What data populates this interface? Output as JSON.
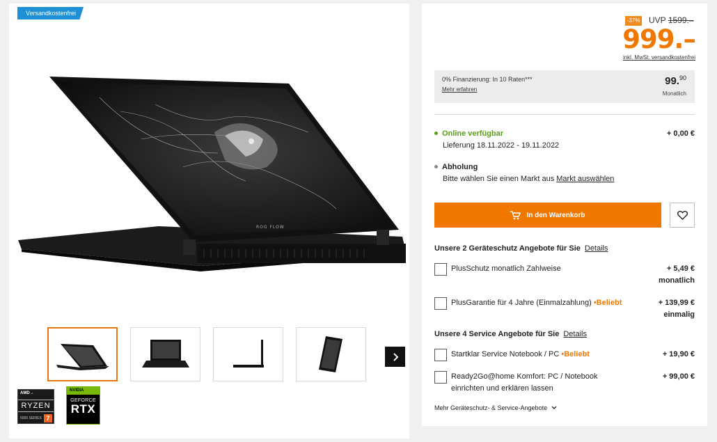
{
  "left": {
    "badge": "Versandkostenfrei"
  },
  "badges": {
    "amd": "AMD→",
    "ryzen": "RYZEN",
    "series": "5000 SERIES",
    "ryzen_num": "7",
    "nvidia": "NVIDIA",
    "geforce": "GEFORCE",
    "rtx": "RTX"
  },
  "price": {
    "discount": "-37%",
    "uvp_label": "UVP",
    "uvp_value": "1599.–",
    "current": "999.–",
    "tax_note": "inkl. MwSt. versandkostenfrei"
  },
  "finance": {
    "label": "0% Finanzierung: In 10 Raten***",
    "more": "Mehr erfahren",
    "rate_main": "99.",
    "rate_cents": "90",
    "monthly": "Monatlich"
  },
  "availability": {
    "online_title": "Online verfügbar",
    "online_date": "Lieferung 18.11.2022 - 19.11.2022",
    "online_price": "+ 0,00 €",
    "pickup_title": "Abholung",
    "pickup_text": "Bitte wählen Sie einen Markt aus",
    "pickup_link": "Markt auswählen",
    "colors": {
      "online": "#5a9e1a",
      "pickup": "#888888"
    }
  },
  "actions": {
    "cart": "In den Warenkorb"
  },
  "protection": {
    "heading": "Unsere 2 Geräteschutz Angebote für Sie",
    "details": "Details",
    "items": [
      {
        "label": "PlusSchutz monatlich Zahlweise",
        "price": "+ 5,49 €",
        "price2": "monatlich",
        "beliebt": ""
      },
      {
        "label": "PlusGarantie für 4 Jahre (Einmalzahlung)",
        "price": "+ 139,99 €",
        "price2": "einmalig",
        "beliebt": "•Beliebt"
      }
    ]
  },
  "service": {
    "heading": "Unsere 4 Service Angebote für Sie",
    "details": "Details",
    "items": [
      {
        "label": "Startklar Service Notebook / PC",
        "price": "+ 19,90 €",
        "beliebt": "•Beliebt",
        "label2": ""
      },
      {
        "label": "Ready2Go@home Komfort: PC / Notebook",
        "label2": "einrichten und erklären lassen",
        "price": "+ 99,00 €",
        "beliebt": ""
      }
    ]
  },
  "more_offers": "Mehr Geräteschutz- & Service-Angebote",
  "colors": {
    "accent": "#f07800",
    "badge_blue": "#1e90d6"
  }
}
